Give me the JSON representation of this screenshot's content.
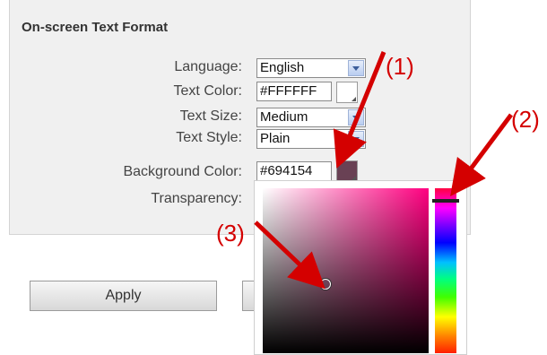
{
  "panel": {
    "title": "On-screen Text Format"
  },
  "form": {
    "language_label": "Language:",
    "language_value": "English",
    "text_color_label": "Text Color:",
    "text_color_value": "#FFFFFF",
    "text_size_label": "Text Size:",
    "text_size_value": "Medium",
    "text_style_label": "Text Style:",
    "text_style_value": "Plain",
    "bg_color_label": "Background Color:",
    "bg_color_value": "#694154",
    "transparency_label": "Transparency:"
  },
  "buttons": {
    "apply": "Apply"
  },
  "annotations": {
    "a1": "(1)",
    "a2": "(2)",
    "a3": "(3)"
  },
  "colors": {
    "background_swatch": "#694154",
    "annotation": "#d40000"
  }
}
